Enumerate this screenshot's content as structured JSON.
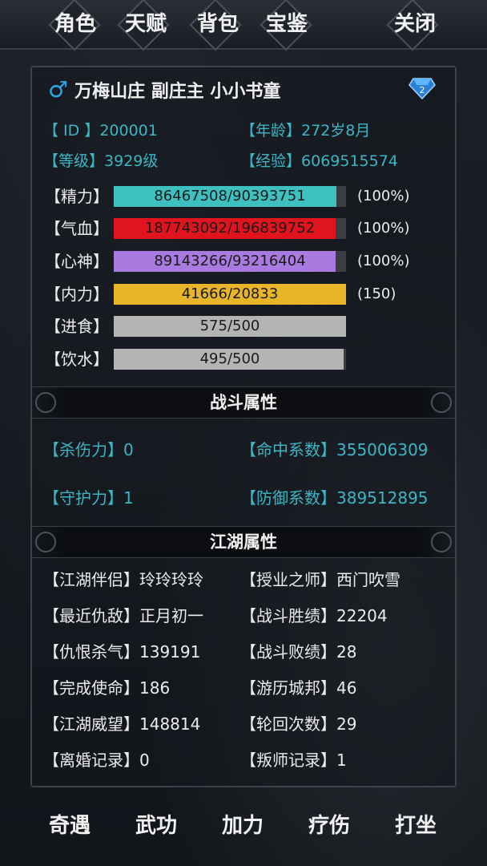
{
  "tabs": [
    "角色",
    "天赋",
    "背包",
    "宝鉴"
  ],
  "close_label": "关闭",
  "header": {
    "gender_icon": "male-symbol",
    "title": "万梅山庄 副庄主 小小书童",
    "gem_icon": "diamond-gem",
    "gem_label": "2"
  },
  "info": {
    "id_label": "【  ID  】",
    "id_value": "200001",
    "age_label": "【年龄】",
    "age_value": "272岁8月",
    "level_label": "【等级】",
    "level_value": "3929级",
    "exp_label": "【经验】",
    "exp_value": "6069515574"
  },
  "bars": [
    {
      "label": "【精力】",
      "text": "86467508/90393751",
      "percent": "(100%)",
      "fill": 0.957,
      "color": "#3fc0c0"
    },
    {
      "label": "【气血】",
      "text": "187743092/196839752",
      "percent": "(100%)",
      "fill": 0.954,
      "color": "#e0141e"
    },
    {
      "label": "【心神】",
      "text": "89143266/93216404",
      "percent": "(100%)",
      "fill": 0.956,
      "color": "#a97ae0"
    },
    {
      "label": "【内力】",
      "text": "41666/20833",
      "percent": "(150)",
      "fill": 1.0,
      "color": "#e8b428"
    },
    {
      "label": "【进食】",
      "text": "575/500",
      "percent": "",
      "fill": 1.0,
      "color": "#b4b4b4"
    },
    {
      "label": "【饮水】",
      "text": "495/500",
      "percent": "",
      "fill": 0.99,
      "color": "#b4b4b4"
    }
  ],
  "combat": {
    "title": "战斗属性",
    "kill_label": "【杀伤力】",
    "kill_value": "0",
    "hit_label": "【命中系数】",
    "hit_value": "355006309",
    "guard_label": "【守护力】",
    "guard_value": "1",
    "def_label": "【防御系数】",
    "def_value": "389512895"
  },
  "jianghu": {
    "title": "江湖属性",
    "items": [
      {
        "label": "【江湖伴侣】",
        "value": "玲玲玲玲"
      },
      {
        "label": "【授业之师】",
        "value": "西门吹雪"
      },
      {
        "label": "【最近仇敌】",
        "value": "正月初一"
      },
      {
        "label": "【战斗胜绩】",
        "value": "22204"
      },
      {
        "label": "【仇恨杀气】",
        "value": "139191"
      },
      {
        "label": "【战斗败绩】",
        "value": "28"
      },
      {
        "label": "【完成使命】",
        "value": "186"
      },
      {
        "label": "【游历城邦】",
        "value": "46"
      },
      {
        "label": "【江湖威望】",
        "value": "148814"
      },
      {
        "label": "【轮回次数】",
        "value": "29"
      },
      {
        "label": "【离婚记录】",
        "value": "0"
      },
      {
        "label": "【叛师记录】",
        "value": "1"
      }
    ]
  },
  "bottom_buttons": [
    "奇遇",
    "武功",
    "加力",
    "疗伤",
    "打坐"
  ]
}
